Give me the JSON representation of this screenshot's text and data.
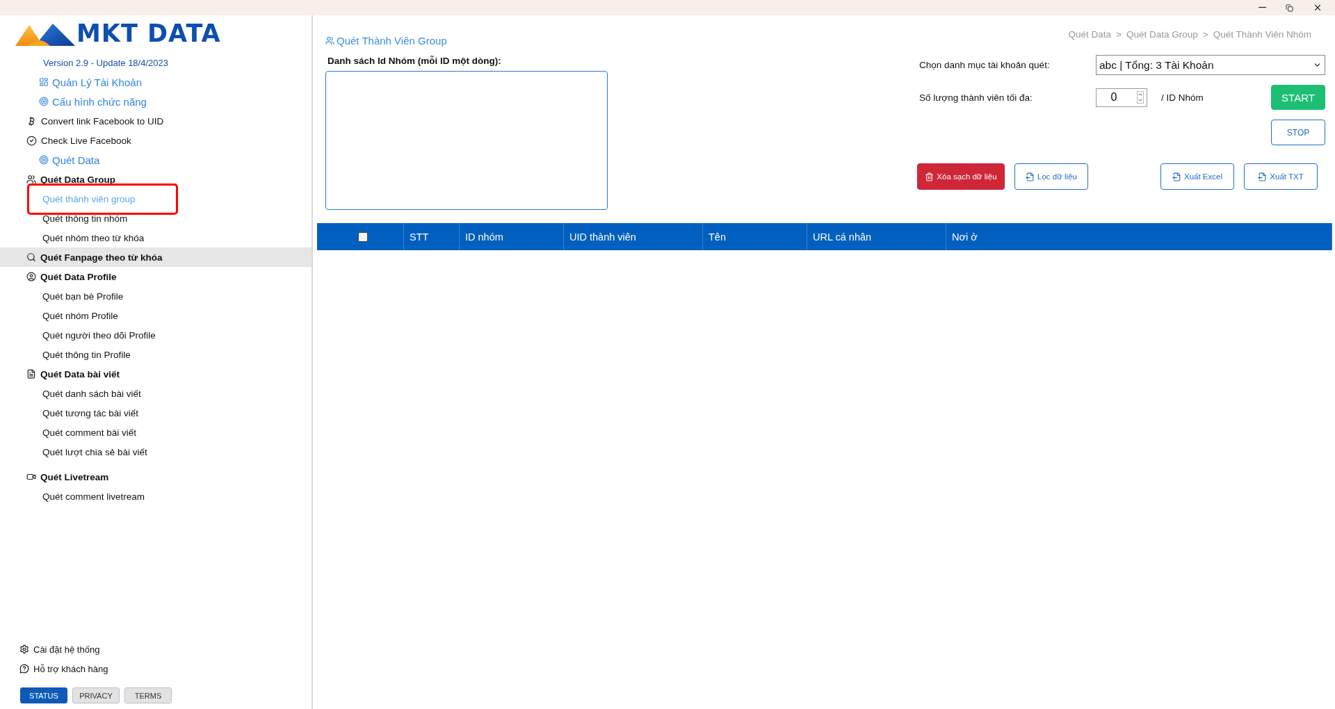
{
  "sidebar": {
    "logo": "MKT DATA",
    "version": "Version 2.9 - Update 18/4/2023",
    "nav": [
      {
        "kind": "link",
        "label": "Quản Lý Tài Khoản"
      },
      {
        "kind": "link",
        "label": "Cấu hình chức năng"
      },
      {
        "kind": "tool",
        "label": "Convert link Facebook to UID"
      },
      {
        "kind": "tool",
        "label": "Check Live Facebook"
      },
      {
        "kind": "link",
        "label": "Quét Data"
      },
      {
        "kind": "group",
        "label": "Quét Data Group",
        "hovered": false,
        "children": [
          {
            "label": "Quét thành viên group",
            "selected": true
          },
          {
            "label": "Quét thông tin nhóm",
            "selected": false
          },
          {
            "label": "Quét nhóm theo từ khóa",
            "selected": false
          }
        ]
      },
      {
        "kind": "group",
        "label": "Quét Fanpage theo từ khóa",
        "hovered": true
      },
      {
        "kind": "group",
        "label": "Quét Data Profile",
        "hovered": false,
        "children": [
          {
            "label": "Quét bạn bè Profile",
            "selected": false
          },
          {
            "label": "Quét nhóm Profile",
            "selected": false
          },
          {
            "label": "Quét người theo dõi Profile",
            "selected": false
          },
          {
            "label": "Quét thông tin Profile",
            "selected": false
          }
        ]
      },
      {
        "kind": "group",
        "label": "Quét Data bài viết",
        "hovered": false,
        "children": [
          {
            "label": "Quét danh sách bài viết",
            "selected": false
          },
          {
            "label": "Quét tương tác bài viết",
            "selected": false
          },
          {
            "label": "Quét comment bài viết",
            "selected": false
          },
          {
            "label": "Quét lượt chia sẻ bài viết",
            "selected": false
          }
        ]
      },
      {
        "kind": "group",
        "label": "Quét Livetream",
        "hovered": false,
        "children": [
          {
            "label": "Quét comment livetream",
            "selected": false
          }
        ]
      }
    ],
    "footer_links": [
      "Cài đặt hệ thống",
      "Hỗ trợ khách hàng"
    ],
    "footer_tabs": [
      {
        "label": "STATUS",
        "selected": true
      },
      {
        "label": "PRIVACY",
        "selected": false
      },
      {
        "label": "TERMS",
        "selected": false
      }
    ]
  },
  "page": {
    "title": "Quét Thành Viên Group",
    "breadcrumb": [
      "Quét Data",
      "Quét Data Group",
      "Quét Thành Viên Nhóm"
    ],
    "breadcrumb_separator": ">",
    "ids_label": "Danh sách Id Nhóm (mỗi ID một dòng):",
    "account_label": "Chọn danh mục tài khoản quét:",
    "account_value": "abc | Tổng: 3 Tài Khoản",
    "max_label": "Số lượng thành viên tối đa:",
    "max_value": "0",
    "max_unit": "/ ID Nhóm",
    "start": "START",
    "stop": "STOP",
    "actions": [
      {
        "kind": "danger",
        "label": "Xóa sạch dữ liệu"
      },
      {
        "kind": "outline",
        "label": "Lọc dữ liệu"
      },
      {
        "kind": "outline",
        "label": "Xuất Excel"
      },
      {
        "kind": "outline",
        "label": "Xuất TXT"
      }
    ]
  },
  "table": {
    "select_all": {
      "checked": false
    },
    "columns": [
      "STT",
      "ID nhóm",
      "UID thành viên",
      "Tên",
      "URL cá nhân",
      "Nơi ở"
    ]
  }
}
